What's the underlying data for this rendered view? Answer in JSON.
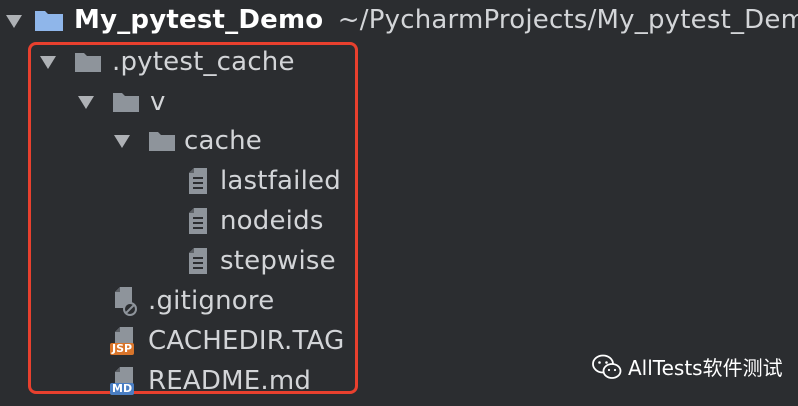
{
  "project": {
    "name": "My_pytest_Demo",
    "path": "~/PycharmProjects/My_pytest_Demo"
  },
  "tree": {
    "pytest_cache": ".pytest_cache",
    "v": "v",
    "cache": "cache",
    "lastfailed": "lastfailed",
    "nodeids": "nodeids",
    "stepwise": "stepwise",
    "gitignore": ".gitignore",
    "cachedir_tag": "CACHEDIR.TAG",
    "readme": "README.md"
  },
  "badges": {
    "jsp": "JSP",
    "md": "MD"
  },
  "watermark": {
    "text": "AllTests软件测试"
  },
  "colors": {
    "highlight": "#e8402e",
    "project_icon": "#8fb6ea",
    "folder": "#8e949b",
    "jsp_badge": "#d9752b",
    "md_badge": "#4a7ec3"
  }
}
